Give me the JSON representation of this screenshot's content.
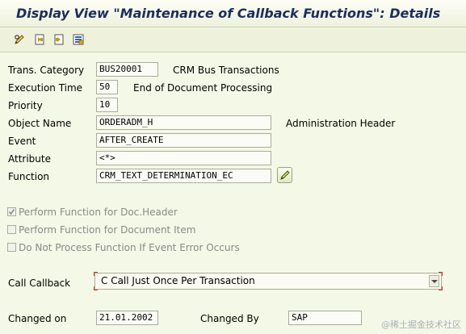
{
  "window": {
    "title": "Display View \"Maintenance of Callback Functions\": Details"
  },
  "toolbar": {
    "buttons": [
      {
        "icon": "display-change-icon"
      },
      {
        "icon": "previous-entry-icon"
      },
      {
        "icon": "next-entry-icon"
      },
      {
        "icon": "select-all-icon"
      }
    ]
  },
  "form": {
    "trans_category": {
      "label": "Trans. Category",
      "value": "BUS20001",
      "description": "CRM Bus Transactions"
    },
    "execution_time": {
      "label": "Execution Time",
      "value": "50",
      "description": "End of Document Processing"
    },
    "priority": {
      "label": "Priority",
      "value": "10"
    },
    "object_name": {
      "label": "Object Name",
      "value": "ORDERADM_H",
      "description": "Administration Header"
    },
    "event": {
      "label": "Event",
      "value": "AFTER_CREATE"
    },
    "attribute": {
      "label": "Attribute",
      "value": "<*>"
    },
    "function": {
      "label": "Function",
      "value": "CRM_TEXT_DETERMINATION_EC"
    }
  },
  "checkboxes": [
    {
      "label": "Perform Function for Doc.Header",
      "checked": true
    },
    {
      "label": "Perform Function for Document Item",
      "checked": false
    },
    {
      "label": "Do Not Process Function If Event Error Occurs",
      "checked": false
    }
  ],
  "call_callback": {
    "label": "Call Callback",
    "selected": "C Call Just Once Per Transaction"
  },
  "changed": {
    "on_label": "Changed on",
    "on_value": "21.01.2002",
    "by_label": "Changed By",
    "by_value": "SAP"
  },
  "watermark": "@稀土掘金技术社区",
  "colors": {
    "title_text": "#1b2e5c",
    "background": "#f4f8e6",
    "required_marker": "#e03020"
  }
}
